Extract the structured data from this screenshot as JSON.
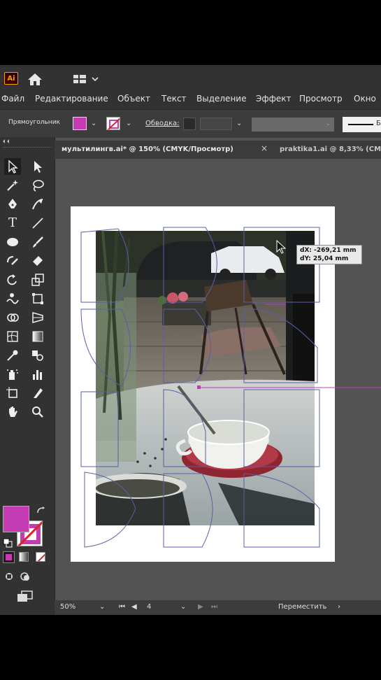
{
  "app": {
    "logo_text": "Ai"
  },
  "menu": [
    "Файл",
    "Редактирование",
    "Объект",
    "Текст",
    "Выделение",
    "Эффект",
    "Просмотр",
    "Окно"
  ],
  "control_bar": {
    "object_type": "Прямоугольник",
    "stroke_label": "Обводка:",
    "fill_color": "#c43bb4",
    "profile_text": "Б"
  },
  "tabs": [
    {
      "title": "мультилингв.ai* @ 150% (CMYK/Просмотр)",
      "active": true
    },
    {
      "title": "praktika1.ai @ 8,33% (CM",
      "active": false
    }
  ],
  "tooltip": {
    "dx": "dX: -269,21 mm",
    "dy": "dY: 25,04 mm"
  },
  "status": {
    "zoom": "50%",
    "artboard_number": "4",
    "tool_state": "Переместить"
  },
  "icons": [
    "ai-logo-icon",
    "home-icon",
    "workspace-icon",
    "selection-tool-icon",
    "direct-selection-icon",
    "magic-wand-icon",
    "lasso-icon",
    "pen-tool-icon",
    "curvature-icon",
    "type-tool-icon",
    "line-tool-icon",
    "ellipse-tool-icon",
    "paintbrush-icon",
    "shaper-icon",
    "eraser-icon",
    "rotate-icon",
    "scale-icon",
    "warp-icon",
    "free-transform-icon",
    "shape-builder-icon",
    "perspective-icon",
    "mesh-icon",
    "gradient-icon",
    "eyedropper-icon",
    "blend-icon",
    "symbol-sprayer-icon",
    "graph-icon",
    "artboard-tool-icon",
    "slice-icon",
    "hand-icon",
    "zoom-icon",
    "swap-icon",
    "default-colors-icon",
    "more-tools-icon"
  ]
}
